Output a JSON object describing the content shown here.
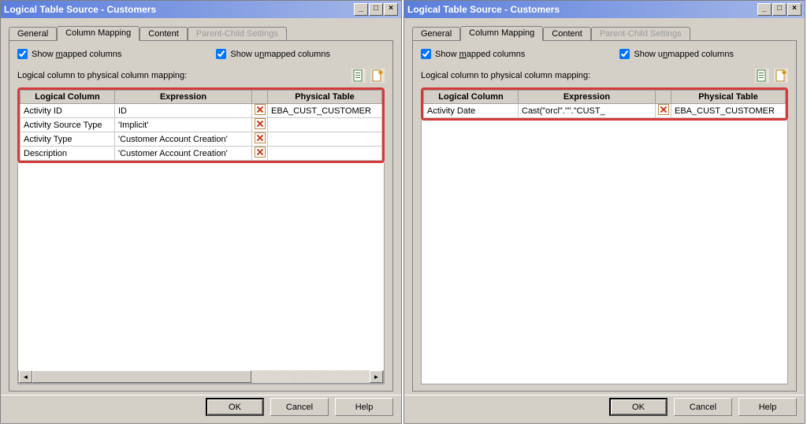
{
  "windows": [
    {
      "title": "Logical Table Source - Customers",
      "tabs": [
        "General",
        "Column Mapping",
        "Content",
        "Parent-Child Settings"
      ],
      "active_tab": 1,
      "disabled_tabs": [
        3
      ],
      "show_mapped_label": "Show mapped columns",
      "show_unmapped_label": "Show unmapped columns",
      "show_mapped_checked": true,
      "show_unmapped_checked": true,
      "mapping_label": "Logical column to physical column mapping:",
      "headers": {
        "logical": "Logical Column",
        "expression": "Expression",
        "physical": "Physical Table"
      },
      "rows": [
        {
          "logical": "Activity ID",
          "expression": "ID",
          "physical": "EBA_CUST_CUSTOMER"
        },
        {
          "logical": "Activity Source Type",
          "expression": "'Implicit'",
          "physical": ""
        },
        {
          "logical": "Activity Type",
          "expression": "'Customer Account Creation'",
          "physical": ""
        },
        {
          "logical": "Description",
          "expression": "'Customer Account Creation'",
          "physical": ""
        }
      ],
      "buttons": {
        "ok": "OK",
        "cancel": "Cancel",
        "help": "Help"
      }
    },
    {
      "title": "Logical Table Source - Customers",
      "tabs": [
        "General",
        "Column Mapping",
        "Content",
        "Parent-Child Settings"
      ],
      "active_tab": 1,
      "disabled_tabs": [
        3
      ],
      "show_mapped_label": "Show mapped columns",
      "show_unmapped_label": "Show unmapped columns",
      "show_mapped_checked": true,
      "show_unmapped_checked": true,
      "mapping_label": "Logical column to physical column mapping:",
      "headers": {
        "logical": "Logical Column",
        "expression": "Expression",
        "physical": "Physical Table"
      },
      "rows": [
        {
          "logical": "Activity Date",
          "expression": "Cast(\"orcl\".\"\".\"CUST_",
          "physical": "EBA_CUST_CUSTOMER"
        }
      ],
      "buttons": {
        "ok": "OK",
        "cancel": "Cancel",
        "help": "Help"
      }
    }
  ],
  "icons": {
    "map_tool": "map-columns-icon",
    "add_tool": "add-column-icon",
    "delete": "delete-mapping-icon"
  }
}
